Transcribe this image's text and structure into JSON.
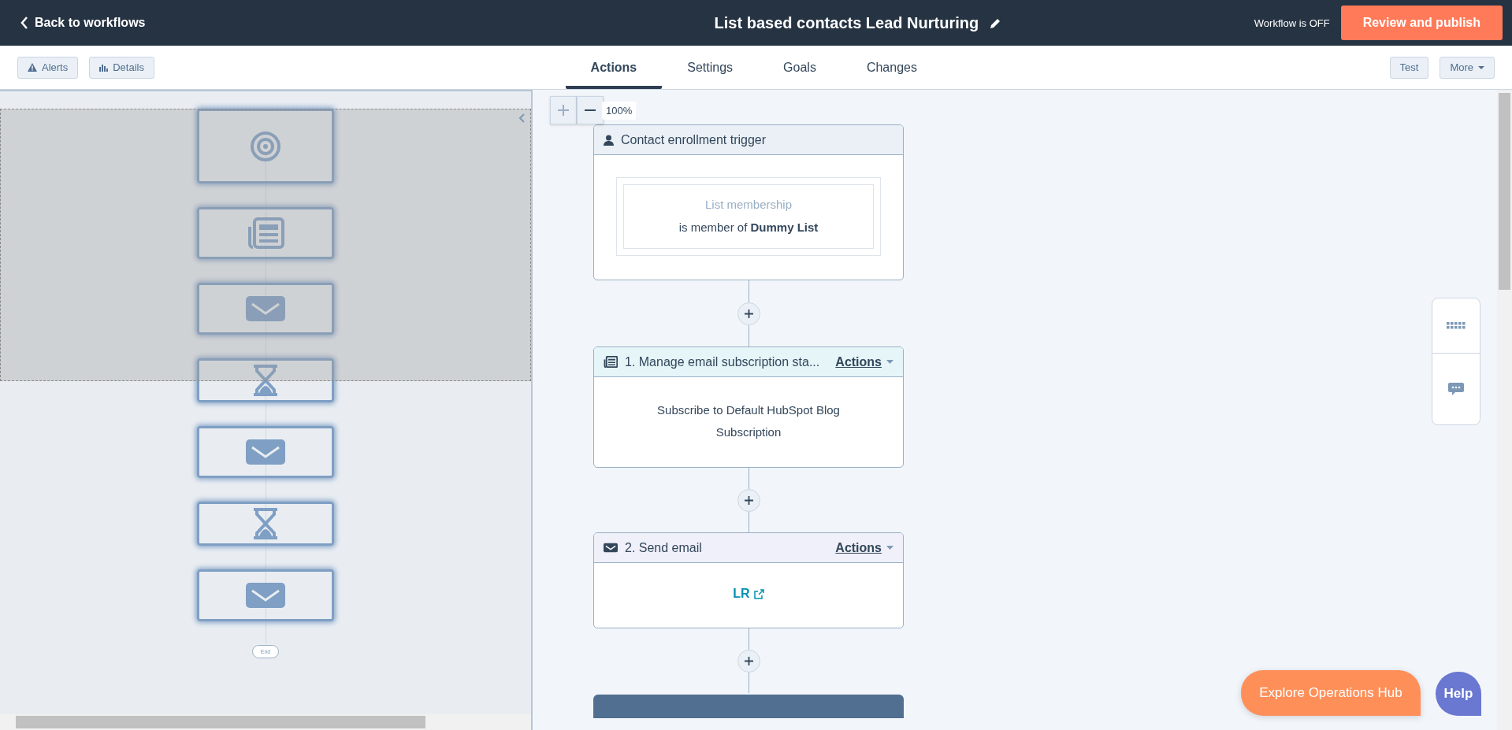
{
  "header": {
    "back_link": "Back to workflows",
    "title": "List based contacts Lead Nurturing",
    "status": "Workflow is OFF",
    "publish_button": "Review and publish"
  },
  "toolbar": {
    "left_buttons": [
      {
        "kind": "alerts",
        "label": "Alerts"
      },
      {
        "kind": "details",
        "label": "Details"
      }
    ],
    "tabs": [
      {
        "label": "Actions",
        "selected": true
      },
      {
        "label": "Settings",
        "selected": false
      },
      {
        "label": "Goals",
        "selected": false
      },
      {
        "label": "Changes",
        "selected": false
      }
    ],
    "test_button": "Test",
    "more_button": "More"
  },
  "minimap": {
    "nodes": [
      {
        "kind": "trigger"
      },
      {
        "kind": "subscription"
      },
      {
        "kind": "email"
      },
      {
        "kind": "delay"
      },
      {
        "kind": "email"
      },
      {
        "kind": "delay"
      },
      {
        "kind": "email"
      }
    ],
    "end_label": "End"
  },
  "zoom": {
    "level_label": "100%"
  },
  "canvas": {
    "trigger": {
      "title": "Contact enrollment trigger",
      "filter_label": "List membership",
      "filter_text": "is member of **Dummy List**"
    },
    "actions": [
      {
        "kind": "subscription",
        "title": "1. Manage email subscription sta...",
        "menu": "Actions",
        "body": "Subscribe to Default HubSpot Blog Subscription"
      },
      {
        "kind": "email",
        "title": "2. Send email",
        "menu": "Actions",
        "link": "LR"
      }
    ]
  },
  "floating": {
    "explore_button": "Explore Operations Hub",
    "help_button": "Help"
  }
}
